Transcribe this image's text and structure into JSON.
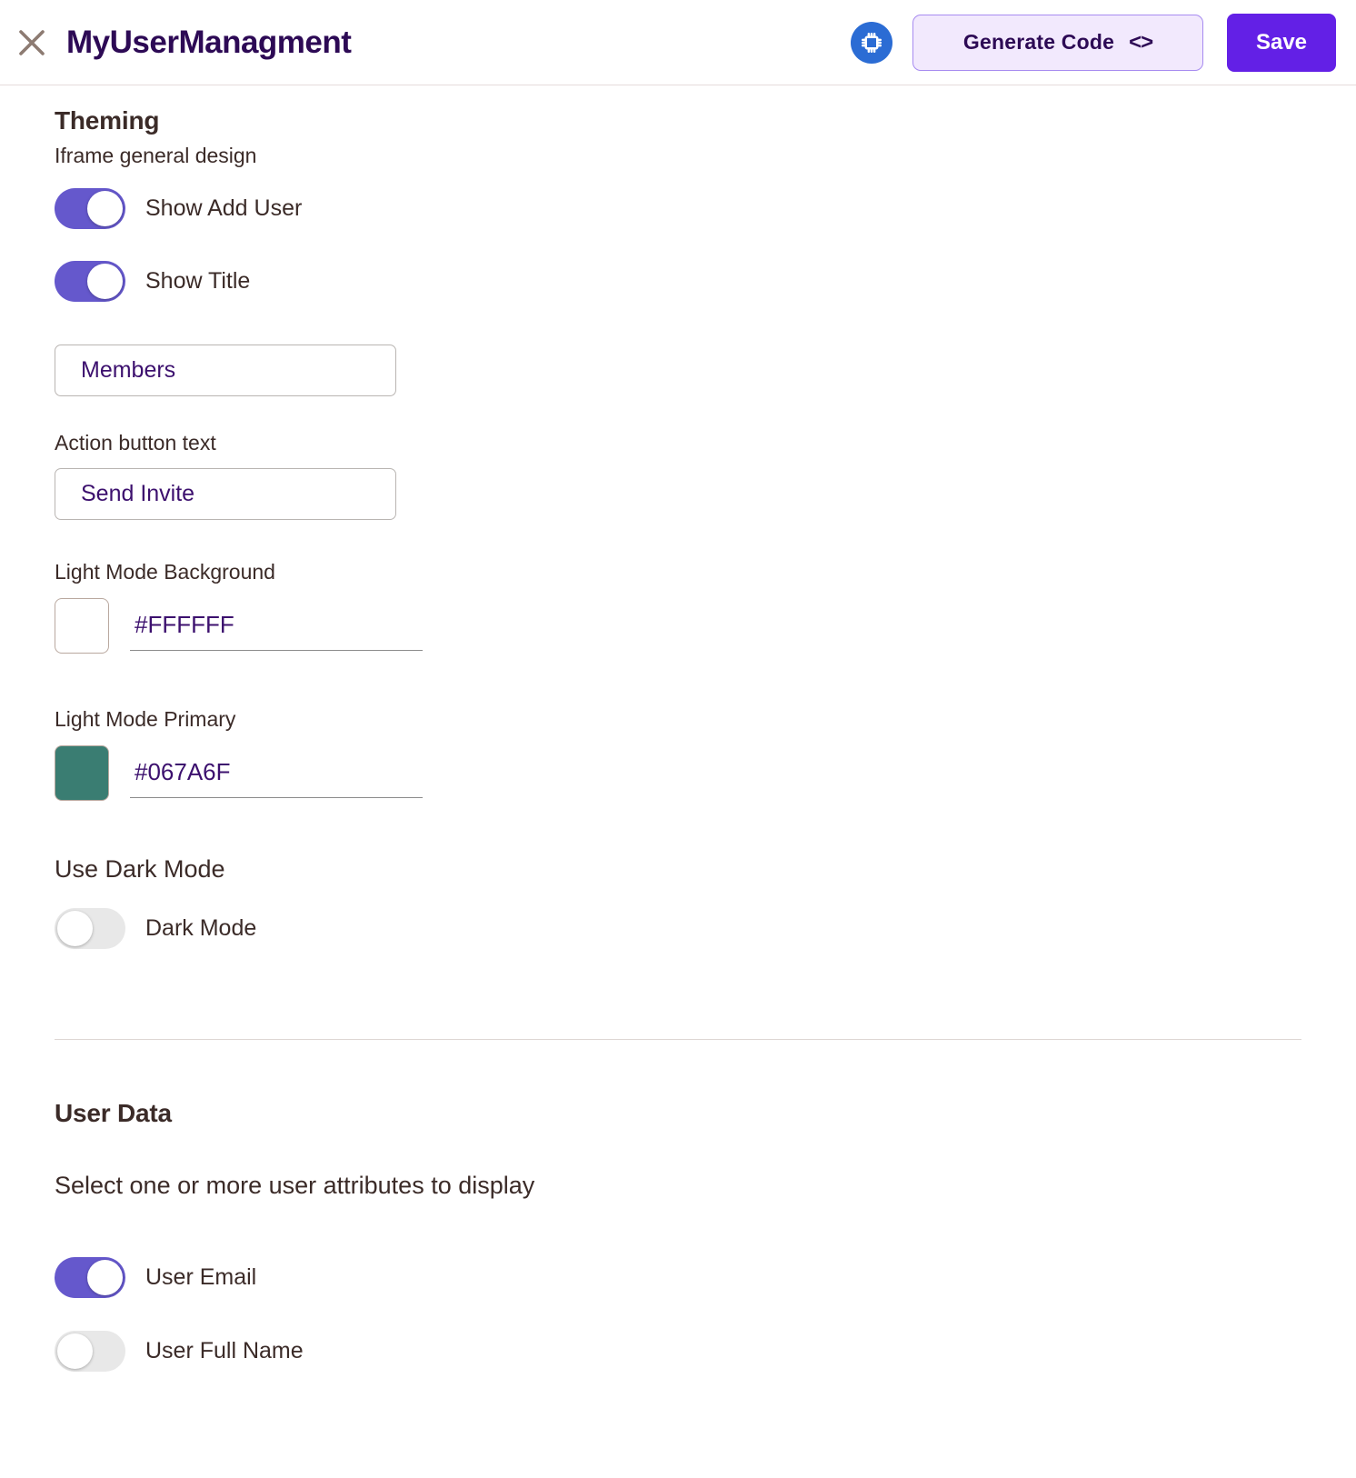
{
  "header": {
    "close_icon": "close-icon",
    "title": "MyUserManagment",
    "chip_icon": "chip-icon",
    "generate_button": "Generate Code",
    "generate_button_icon": "code-brackets-icon",
    "save_button": "Save",
    "save_button_color": "#6320e6",
    "title_color": "#2d0a55",
    "chip_icon_color": "#2b6cd4"
  },
  "theming": {
    "heading": "Theming",
    "subtitle": "Iframe general design",
    "toggles": [
      {
        "label": "Show Add User",
        "state": "on"
      },
      {
        "label": "Show Title",
        "state": "on"
      }
    ],
    "title_input": {
      "value": "Members",
      "placeholder": "Title"
    },
    "action_button_label": "Action button text",
    "action_button_input": {
      "value": "Send Invite",
      "placeholder": "Action button text"
    },
    "light_mode_background": {
      "label": "Light Mode Background",
      "value": "#FFFFFF",
      "swatch": "#FFFFFF"
    },
    "light_mode_primary": {
      "label": "Light Mode Primary",
      "value": "#067A6F",
      "swatch": "#3a7d72"
    },
    "dark_mode_heading": "Use Dark Mode",
    "dark_mode_toggle": {
      "label": "Dark Mode",
      "state": "off"
    }
  },
  "user_data": {
    "heading": "User Data",
    "description": "Select one or more user attributes to display",
    "attributes": [
      {
        "label": "User Email",
        "state": "on"
      },
      {
        "label": "User Full Name",
        "state": "off"
      }
    ]
  },
  "colors": {
    "toggle_on": "#6558cc",
    "toggle_off": "#e8e8e8",
    "accent_purple": "#6320e6",
    "input_text": "#3c106e",
    "body_text": "#3b2b28",
    "close_icon": "#8d7b72"
  }
}
